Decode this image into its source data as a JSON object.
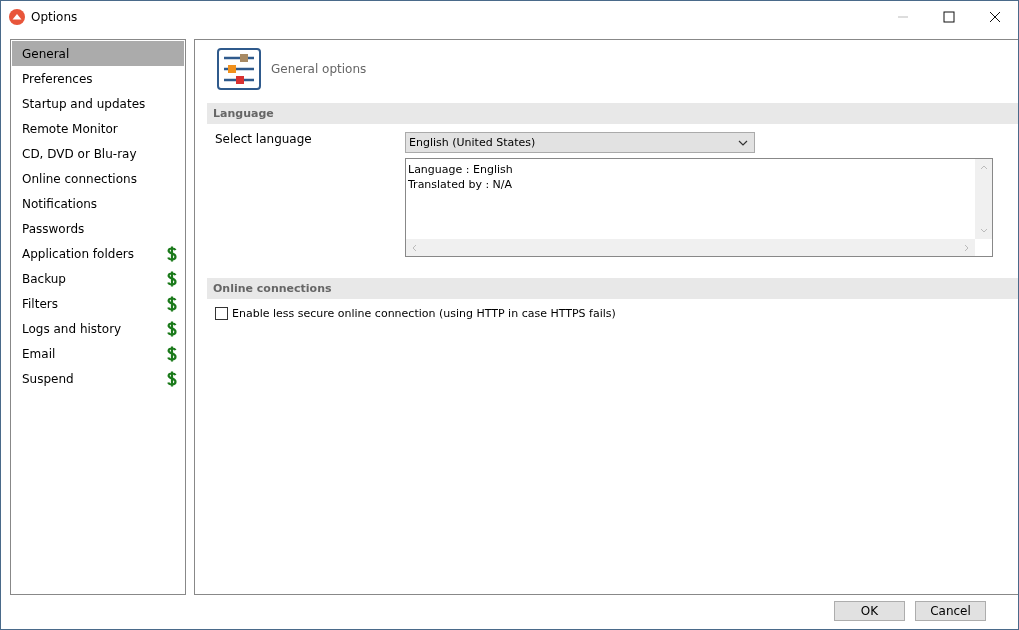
{
  "window": {
    "title": "Options"
  },
  "sidebar": {
    "items": [
      {
        "label": "General",
        "selected": true,
        "paid": false
      },
      {
        "label": "Preferences",
        "selected": false,
        "paid": false
      },
      {
        "label": "Startup and updates",
        "selected": false,
        "paid": false
      },
      {
        "label": "Remote Monitor",
        "selected": false,
        "paid": false
      },
      {
        "label": "CD, DVD or Blu-ray",
        "selected": false,
        "paid": false
      },
      {
        "label": "Online connections",
        "selected": false,
        "paid": false
      },
      {
        "label": "Notifications",
        "selected": false,
        "paid": false
      },
      {
        "label": "Passwords",
        "selected": false,
        "paid": false
      },
      {
        "label": "Application folders",
        "selected": false,
        "paid": true
      },
      {
        "label": "Backup",
        "selected": false,
        "paid": true
      },
      {
        "label": "Filters",
        "selected": false,
        "paid": true
      },
      {
        "label": "Logs and history",
        "selected": false,
        "paid": true
      },
      {
        "label": "Email",
        "selected": false,
        "paid": true
      },
      {
        "label": "Suspend",
        "selected": false,
        "paid": true
      }
    ]
  },
  "page": {
    "title": "General options"
  },
  "language": {
    "heading": "Language",
    "label": "Select language",
    "value": "English (United States)",
    "info": [
      "Language : English",
      "Translated by : N/A"
    ]
  },
  "online": {
    "heading": "Online connections",
    "checkbox": {
      "label": "Enable less secure online connection (using HTTP in case HTTPS fails)",
      "checked": false
    }
  },
  "buttons": [
    "OK",
    "Cancel"
  ]
}
